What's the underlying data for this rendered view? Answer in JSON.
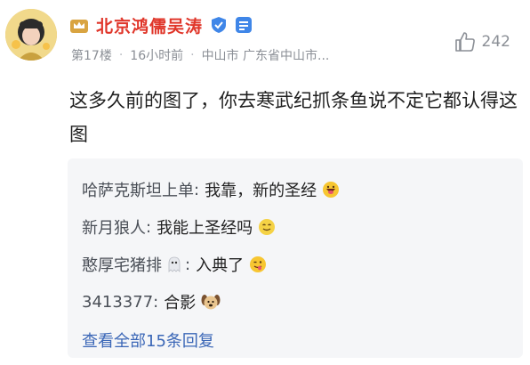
{
  "post": {
    "username": "北京鸿儒吴涛",
    "floor": "第17楼",
    "time": "16小时前",
    "location": "中山市 广东省中山市...",
    "likes": "242",
    "content": "这多久前的图了，你去寒武纪抓条鱼说不定它都认得这图"
  },
  "replies": [
    {
      "name": "哈萨克斯坦上单",
      "separator": ":",
      "text": "我靠，新的圣经",
      "emoji": "grinning-tongue-emoji"
    },
    {
      "name": "新月狼人",
      "separator": ":",
      "text": "我能上圣经吗",
      "emoji": "smiling-face-emoji"
    },
    {
      "name": "憨厚宅猪排",
      "separator": ":",
      "text": "入典了",
      "emoji": "winking-tongue-emoji",
      "name_emoji": "ghost-icon"
    },
    {
      "name": "3413377",
      "separator": ":",
      "text": "合影",
      "emoji": "dog-face-emoji"
    }
  ],
  "view_all": "查看全部15条回复",
  "colors": {
    "username": "#e0362a",
    "meta": "#8b8f96",
    "link": "#3b67b7",
    "reply_bg": "#f5f6f8"
  }
}
